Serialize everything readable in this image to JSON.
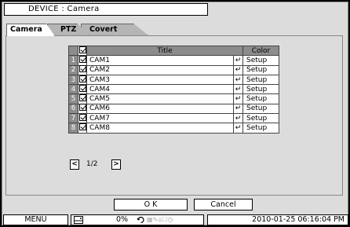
{
  "window": {
    "title": "DEVICE : Camera"
  },
  "tabs": [
    {
      "label": "Camera",
      "active": true
    },
    {
      "label": "PTZ",
      "active": false
    },
    {
      "label": "Covert",
      "active": false
    }
  ],
  "table": {
    "headers": {
      "title": "Title",
      "color": "Color"
    },
    "rows": [
      {
        "num": "1",
        "title": "CAM1",
        "color": "Setup"
      },
      {
        "num": "2",
        "title": "CAM2",
        "color": "Setup"
      },
      {
        "num": "3",
        "title": "CAM3",
        "color": "Setup"
      },
      {
        "num": "4",
        "title": "CAM4",
        "color": "Setup"
      },
      {
        "num": "5",
        "title": "CAM5",
        "color": "Setup"
      },
      {
        "num": "6",
        "title": "CAM6",
        "color": "Setup"
      },
      {
        "num": "7",
        "title": "CAM7",
        "color": "Setup"
      },
      {
        "num": "8",
        "title": "CAM8",
        "color": "Setup"
      }
    ],
    "enter_glyph": "↵"
  },
  "pager": {
    "prev": "<",
    "next": ">",
    "text": "1/2"
  },
  "buttons": {
    "ok": "O K",
    "cancel": "Cancel"
  },
  "statusbar": {
    "menu": "MENU",
    "percent": "0%",
    "datetime": "2010-01-25 06:16:04 PM"
  },
  "colors": {
    "background": "#dcdcdc",
    "header_bg": "#8c8c8c",
    "inactive_tab": "#b5b5b5"
  }
}
